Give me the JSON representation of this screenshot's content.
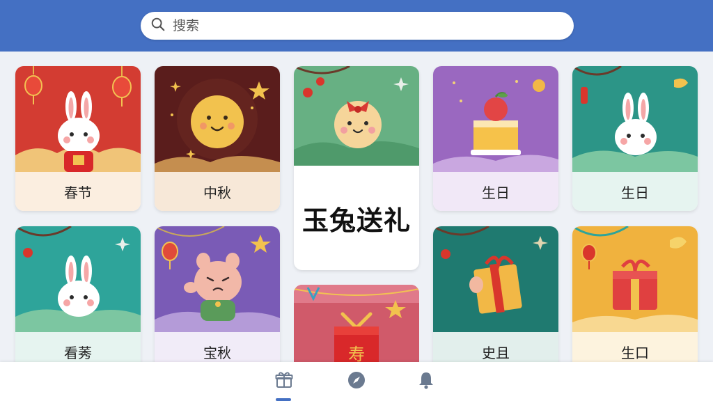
{
  "search": {
    "placeholder": "搜索",
    "value": ""
  },
  "cards": [
    {
      "label": "春节",
      "theme": "red",
      "motif": "rabbit-with-lanterns"
    },
    {
      "label": "中秋",
      "theme": "dark-brown",
      "motif": "moon-face"
    },
    {
      "label": "玉兔送礼",
      "theme": "green",
      "motif": "bun-with-bow",
      "featured": true
    },
    {
      "label": "生日",
      "theme": "purple",
      "motif": "birthday-cake"
    },
    {
      "label": "生日",
      "theme": "teal",
      "motif": "rabbit"
    },
    {
      "label": "看莠",
      "theme": "teal",
      "motif": "rabbit"
    },
    {
      "label": "宝秋",
      "theme": "purple",
      "motif": "bear-cat"
    },
    {
      "label": "",
      "theme": "pink-red",
      "motif": "red-envelope-gift"
    },
    {
      "label": "史且",
      "theme": "dark-teal",
      "motif": "gift-box"
    },
    {
      "label": "生口",
      "theme": "orange",
      "motif": "gift-box"
    }
  ],
  "nav": {
    "items": [
      {
        "icon": "gift-icon",
        "active": true
      },
      {
        "icon": "compass-icon",
        "active": false
      },
      {
        "icon": "bell-icon",
        "active": false
      }
    ]
  },
  "colors": {
    "header": "#4470c3",
    "accent": "#4470c3",
    "background": "#eef1f6"
  }
}
